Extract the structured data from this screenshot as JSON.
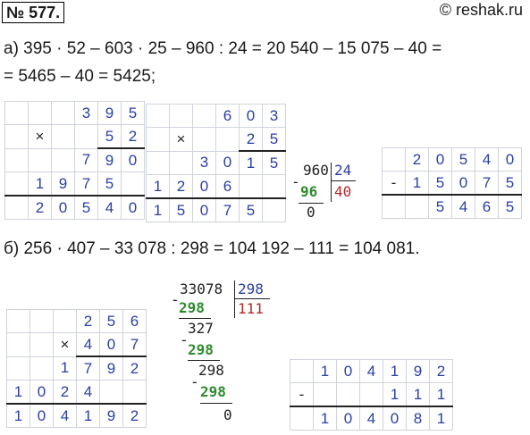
{
  "header": {
    "badge": "№ 577.",
    "site": "© reshak.ru"
  },
  "part_a": {
    "line1": "а) 395 · 52 – 603 · 25 – 960 : 24 = 20 540 – 15 075 – 40 =",
    "line2": "= 5465 – 40 = 5425;",
    "mult1": {
      "op": "×",
      "a": [
        "3",
        "9",
        "5"
      ],
      "b": [
        "5",
        "2"
      ],
      "p1": [
        "7",
        "9",
        "0"
      ],
      "p2": [
        "1",
        "9",
        "7",
        "5"
      ],
      "res": [
        "2",
        "0",
        "5",
        "4",
        "0"
      ]
    },
    "mult2": {
      "op": "×",
      "a": [
        "6",
        "0",
        "3"
      ],
      "b": [
        "2",
        "5"
      ],
      "p1": [
        "3",
        "0",
        "1",
        "5"
      ],
      "p2": [
        "1",
        "2",
        "0",
        "6"
      ],
      "res": [
        "1",
        "5",
        "0",
        "7",
        "5"
      ]
    },
    "division": {
      "minus": "-",
      "dividend": "960",
      "divisor": "24",
      "sub": "96",
      "quotient": "40",
      "rem": "0"
    },
    "subtraction": {
      "op": "-",
      "a": [
        "2",
        "0",
        "5",
        "4",
        "0"
      ],
      "b": [
        "1",
        "5",
        "0",
        "7",
        "5"
      ],
      "res": [
        "5",
        "4",
        "6",
        "5"
      ]
    }
  },
  "part_b": {
    "line": "б) 256 · 407 – 33 078 : 298 = 104 192 – 111 = 104 081.",
    "mult": {
      "op": "×",
      "a": [
        "2",
        "5",
        "6"
      ],
      "b": [
        "4",
        "0",
        "7"
      ],
      "p1": [
        "1",
        "7",
        "9",
        "2"
      ],
      "p3": [
        "1",
        "0",
        "2",
        "4"
      ],
      "res": [
        "1",
        "0",
        "4",
        "1",
        "9",
        "2"
      ]
    },
    "division": {
      "minus": "-",
      "dividend": "33078",
      "divisor": "298",
      "sub1": "298",
      "quotient": "111",
      "r1": "327",
      "sub2": "298",
      "r2": "298",
      "sub3": "298",
      "rem": "0"
    },
    "subtraction": {
      "op": "-",
      "a": [
        "1",
        "0",
        "4",
        "1",
        "9",
        "2"
      ],
      "b": [
        "1",
        "1",
        "1"
      ],
      "res": [
        "1",
        "0",
        "4",
        "0",
        "8",
        "1"
      ]
    }
  }
}
